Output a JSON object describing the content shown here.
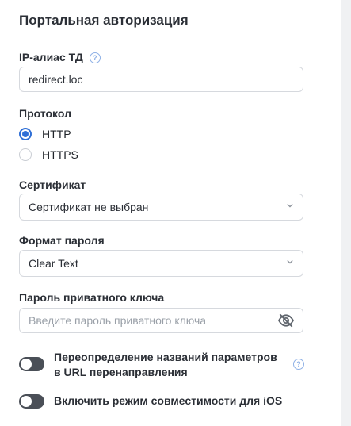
{
  "title": "Портальная авторизация",
  "ip_alias": {
    "label": "IP-алиас ТД",
    "value": "redirect.loc",
    "help_icon": "question-circle-icon"
  },
  "protocol": {
    "label": "Протокол",
    "options": [
      {
        "label": "HTTP",
        "checked": true
      },
      {
        "label": "HTTPS",
        "checked": false
      }
    ]
  },
  "certificate": {
    "label": "Сертификат",
    "value": "Сертификат не выбран"
  },
  "password_format": {
    "label": "Формат пароля",
    "value": "Clear Text"
  },
  "private_key": {
    "label": "Пароль приватного ключа",
    "placeholder": "Введите пароль приватного ключа",
    "icon": "eye-off-icon"
  },
  "toggles": [
    {
      "line1": "Переопределение названий параметров",
      "line2": "в URL перенаправления",
      "on": false,
      "help_icon": "question-circle-icon"
    },
    {
      "line1": "Включить режим совместимости для iOS",
      "on": false
    }
  ],
  "colors": {
    "accent": "#2f6fd6",
    "toggle_off": "#4a4f57",
    "help": "#8fb1e6"
  }
}
